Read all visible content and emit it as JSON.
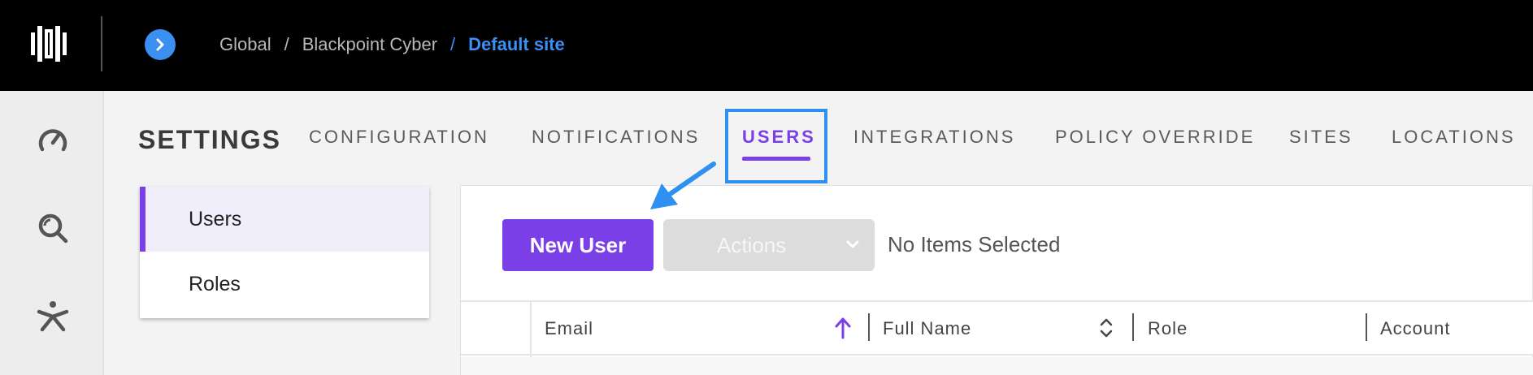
{
  "header": {
    "logo_icon": "brand-logo-icon",
    "expand_icon": "chevron-right-icon",
    "breadcrumbs": [
      "Global",
      "Blackpoint Cyber",
      "Default site"
    ],
    "separator": "/"
  },
  "rail": {
    "icons": [
      "gauge-icon",
      "search-icon",
      "asterisk-person-icon"
    ]
  },
  "settings": {
    "title": "SETTINGS",
    "tabs": [
      "CONFIGURATION",
      "NOTIFICATIONS",
      "USERS",
      "INTEGRATIONS",
      "POLICY OVERRIDE",
      "SITES",
      "LOCATIONS"
    ],
    "active_tab": "USERS"
  },
  "subnav": {
    "items": [
      "Users",
      "Roles"
    ],
    "selected": "Users"
  },
  "toolbar": {
    "new_user_label": "New User",
    "actions_label": "Actions",
    "selection_status": "No Items Selected"
  },
  "table": {
    "columns": [
      "Email",
      "Full Name",
      "Role",
      "Account"
    ],
    "sorted_column": "Email",
    "sort_direction": "ascending"
  },
  "colors": {
    "accent": "#7a3fe6",
    "highlight": "#2e90f0",
    "breadcrumb_active": "#3d8ef5"
  }
}
